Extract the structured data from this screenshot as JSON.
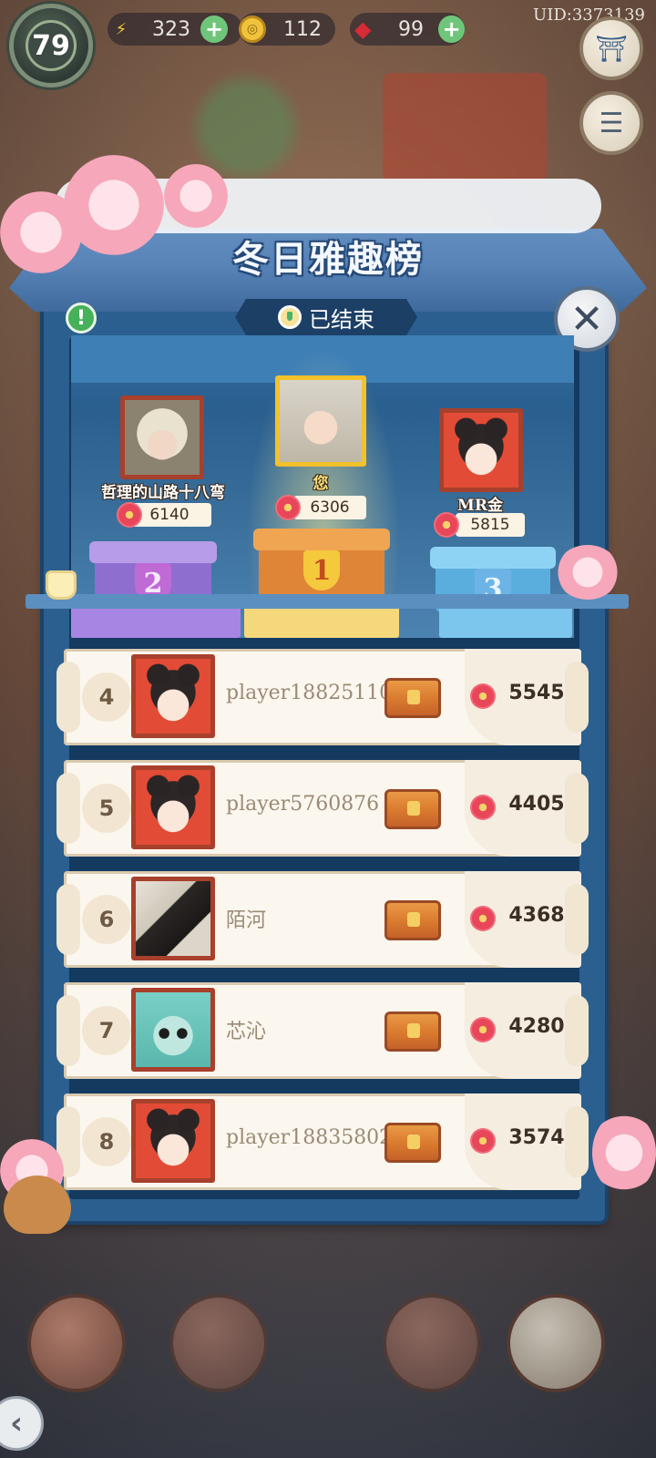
{
  "hud": {
    "level": "79",
    "energy": "323",
    "coins": "112",
    "gems": "99",
    "uid": "UID:3373139"
  },
  "event": {
    "title": "冬日雅趣榜",
    "status": "已结束"
  },
  "podium": [
    {
      "rank": "1",
      "name": "您",
      "score": "6306"
    },
    {
      "rank": "2",
      "name": "哲理的山路十八弯",
      "score": "6140"
    },
    {
      "rank": "3",
      "name": "MR金",
      "score": "5815"
    }
  ],
  "leaderboard": [
    {
      "rank": "4",
      "name": "player18825110",
      "score": "5545"
    },
    {
      "rank": "5",
      "name": "player5760876",
      "score": "4405"
    },
    {
      "rank": "6",
      "name": "陌河",
      "score": "4368"
    },
    {
      "rank": "7",
      "name": "芯沁",
      "score": "4280"
    },
    {
      "rank": "8",
      "name": "player18835802",
      "score": "3574"
    }
  ],
  "colors": {
    "panel_blue": "#2a5f8f",
    "rank1_gold": "#f3c12a",
    "rank2_purple": "#9b7ad6",
    "rank3_blue": "#5fb6e8",
    "flower_red": "#e8475a"
  }
}
